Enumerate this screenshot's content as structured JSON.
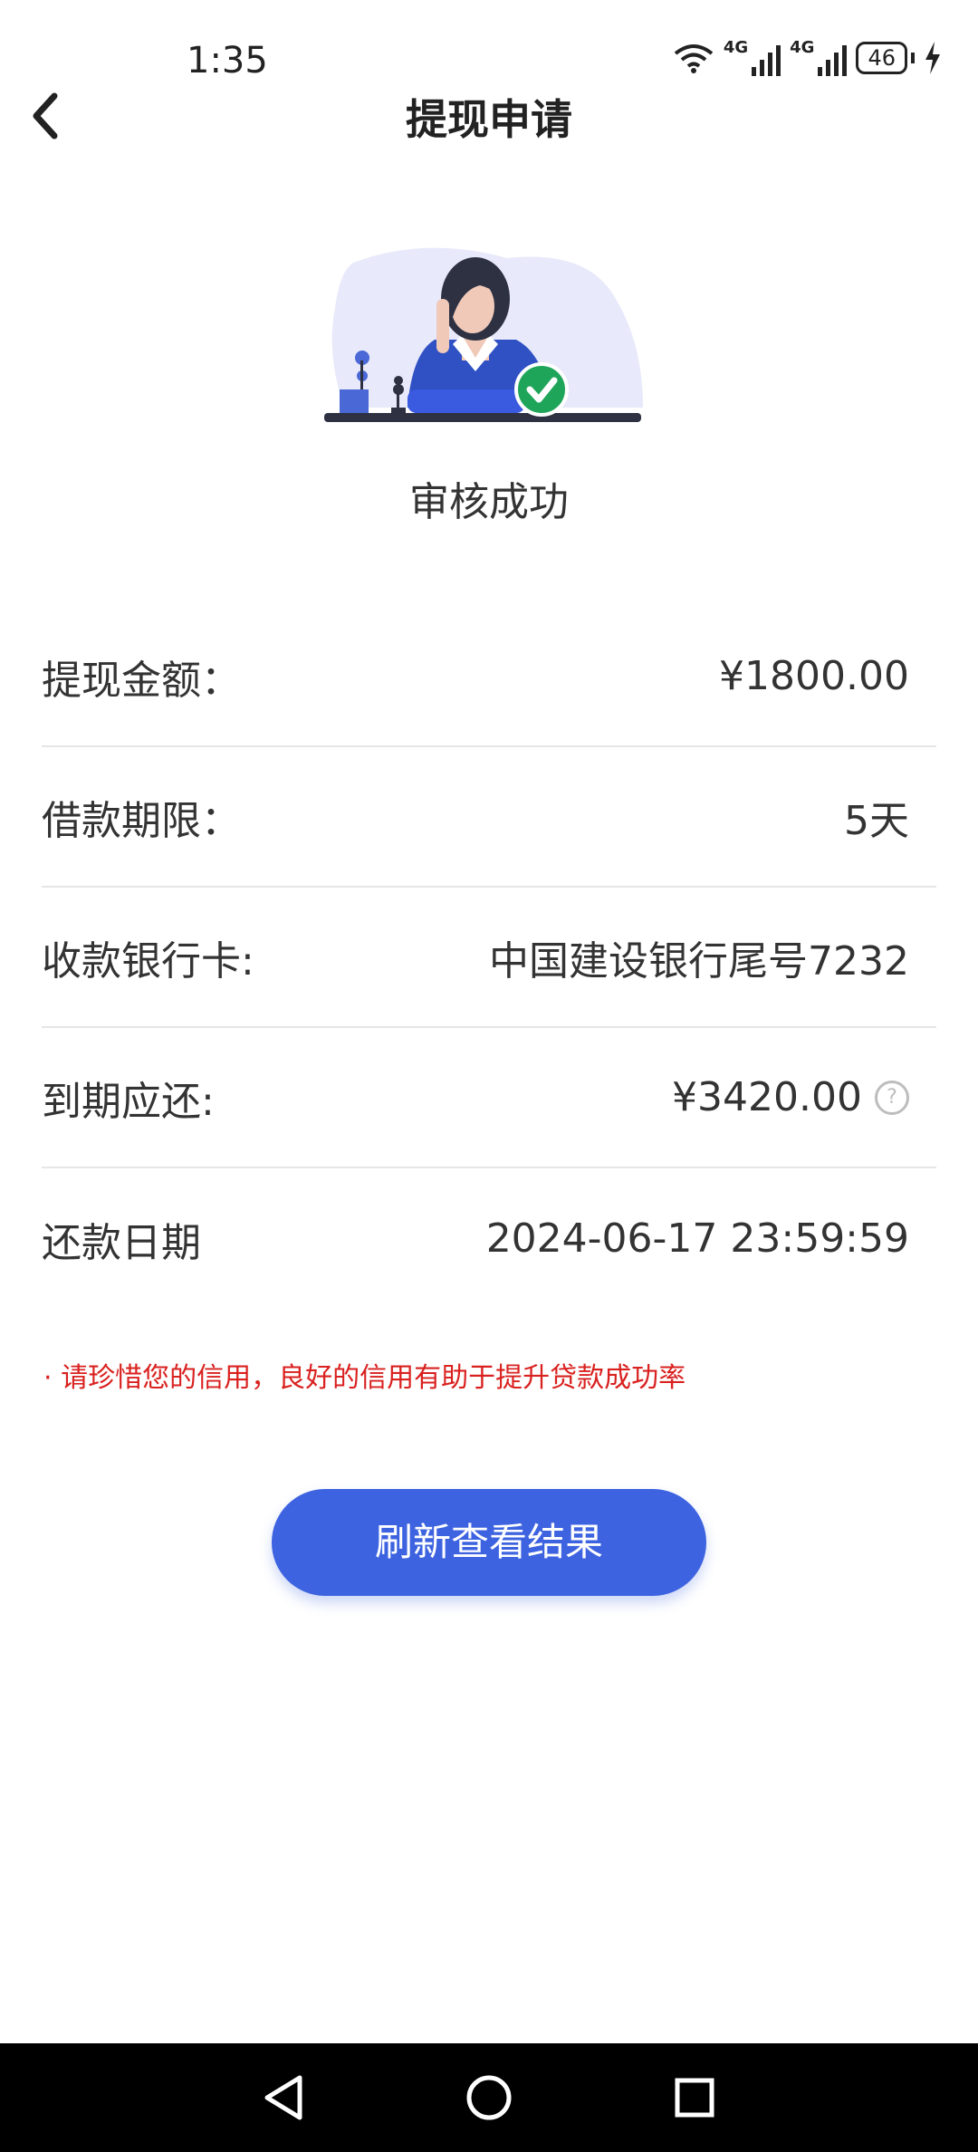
{
  "status_bar": {
    "time": "1:35",
    "network_1": "4G",
    "network_2": "4G",
    "battery": "46",
    "icons": [
      "wifi-icon",
      "signal-icon",
      "signal-icon",
      "battery-icon",
      "charging-icon"
    ]
  },
  "header": {
    "title": "提现申请",
    "back_icon": "back-arrow-icon"
  },
  "result": {
    "status_text": "审核成功",
    "icon": "check-circle-icon",
    "accent_color": "#1fa55a"
  },
  "details": [
    {
      "label": "提现金额：",
      "value": "¥1800.00"
    },
    {
      "label": "借款期限：",
      "value": "5天"
    },
    {
      "label": "收款银行卡:",
      "value": "中国建设银行尾号7232"
    },
    {
      "label": "到期应还:",
      "value": "¥3420.00"
    },
    {
      "label": "还款日期",
      "value": "2024-06-17 23:59:59"
    }
  ],
  "notice": "· 请珍惜您的信用，良好的信用有助于提升贷款成功率",
  "refresh_button": {
    "label": "刷新查看结果",
    "color": "#3d63e0"
  },
  "nav_bar": {
    "icons": [
      "back-triangle-icon",
      "home-circle-icon",
      "recents-square-icon"
    ]
  }
}
